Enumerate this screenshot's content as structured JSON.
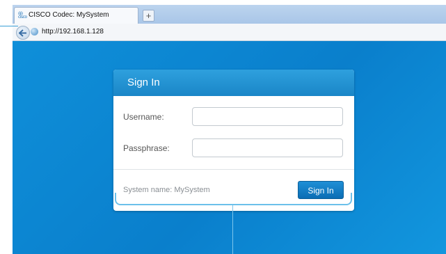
{
  "browser": {
    "tab_favicon": "cisco-logo-icon",
    "tab_title": "CISCO Codec: MySystem",
    "new_tab_label": "+",
    "url": "http://192.168.1.128"
  },
  "signin": {
    "title": "Sign In",
    "username_label": "Username:",
    "username_value": "",
    "passphrase_label": "Passphrase:",
    "passphrase_value": "",
    "system_name": "System name: MySystem",
    "signin_button": "Sign In"
  },
  "colors": {
    "page_background": "#0a7fcc",
    "header_blue": "#2ea0de",
    "button_blue": "#0b6db4",
    "callout_line": "#6cc0ea"
  }
}
